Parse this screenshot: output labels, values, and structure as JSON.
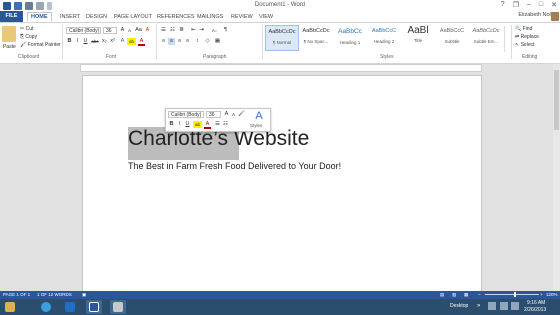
{
  "window": {
    "title": "Document1 - Word"
  },
  "quick_access": {
    "icons": [
      "word-app-icon",
      "save-icon",
      "undo-icon",
      "redo-icon",
      "customize-icon"
    ],
    "colors": {
      "word": "#2b579a"
    }
  },
  "window_controls": {
    "help": "?",
    "ribbon_opts": "❐",
    "minimize": "–",
    "maximize": "□",
    "close": "✕"
  },
  "tabs": {
    "file": "FILE",
    "items": [
      "HOME",
      "INSERT",
      "DESIGN",
      "PAGE LAYOUT",
      "REFERENCES",
      "MAILINGS",
      "REVIEW",
      "VIEW"
    ],
    "active": "HOME"
  },
  "user": {
    "name": "Elizabeth Noll"
  },
  "clipboard": {
    "paste": "Paste",
    "cut": "Cut",
    "copy": "Copy",
    "format_painter": "Format Painter",
    "label": "Clipboard"
  },
  "font": {
    "name": "Calibri (Body)",
    "size": "36",
    "grow": "A",
    "shrink": "A",
    "case": "Aa",
    "clear": "A",
    "bold": "B",
    "italic": "I",
    "underline": "U",
    "strike": "abc",
    "sub": "x₂",
    "sup": "x²",
    "effects": "A",
    "highlight": "ab",
    "color": "A",
    "label": "Font"
  },
  "paragraph": {
    "label": "Paragraph",
    "pilcrow": "¶",
    "sort": "A↓"
  },
  "styles": {
    "label": "Styles",
    "items": [
      {
        "sample": "AaBbCcDc",
        "name": "¶ Normal"
      },
      {
        "sample": "AaBbCcDc",
        "name": "¶ No Spac..."
      },
      {
        "sample": "AaBbCc",
        "name": "Heading 1"
      },
      {
        "sample": "AaBbCcC",
        "name": "Heading 2"
      },
      {
        "sample": "AaBl",
        "name": "Title"
      },
      {
        "sample": "AaBbCcC",
        "name": "Subtitle"
      },
      {
        "sample": "AaBbCcDc",
        "name": "Subtle Em..."
      },
      {
        "sample": "AaBbCcDc",
        "name": "Emphasis"
      }
    ],
    "selected": 0
  },
  "editing": {
    "find": "Find",
    "replace": "Replace",
    "select": "Select",
    "label": "Editing"
  },
  "document": {
    "heading": "Charlotte’s Website",
    "subtitle": "The Best in Farm Fresh Food Delivered to Your Door!"
  },
  "mini_toolbar": {
    "font": "Calibri (Body)",
    "size": "36",
    "grow": "A",
    "shrink": "A",
    "painter": "🖌",
    "bold": "B",
    "italic": "I",
    "underline": "U",
    "highlight": "ab",
    "color": "A",
    "bullets": "☰",
    "numbering": "☷",
    "styles_label": "Styles",
    "styles_glyph": "A"
  },
  "status": {
    "page": "PAGE 1 OF 1",
    "words": "1 OF 12 WORDS",
    "zoom": "120%"
  },
  "taskbar": {
    "desktop": "Desktop",
    "time": "9:16 AM",
    "date": "2/26/2013",
    "apps": [
      "explorer-icon",
      "ie-icon",
      "outlook-icon",
      "word-icon",
      "snipping-icon"
    ]
  }
}
